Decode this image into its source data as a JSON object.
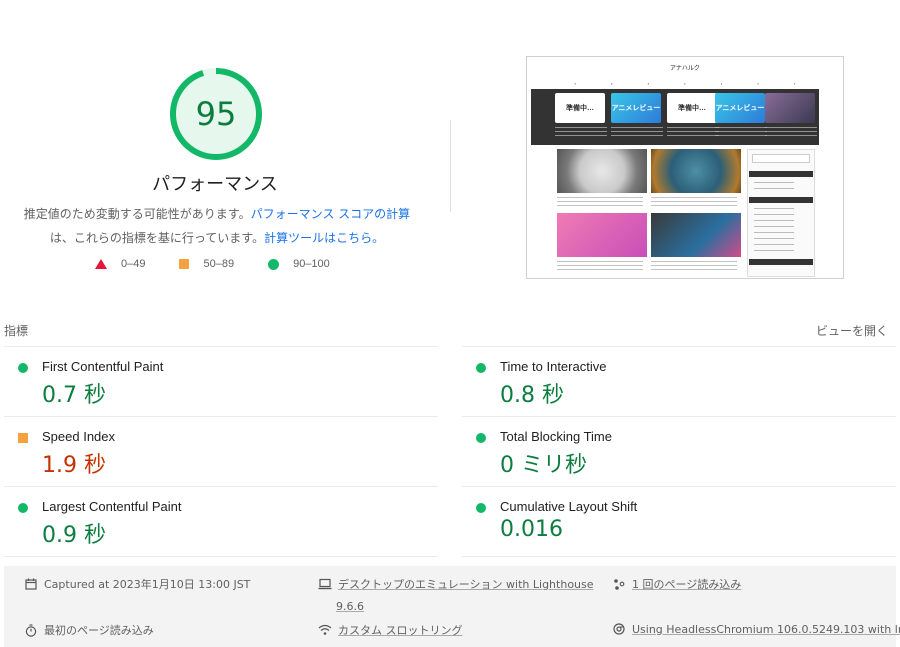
{
  "gauge": {
    "score": "95",
    "score_value": 95,
    "title": "パフォーマンス",
    "desc_prefix": "推定値のため変動する可能性があります。",
    "desc_link1": "パフォーマンス スコアの計算",
    "desc_middle": "は、これらの指標を基に行っています。",
    "desc_link2": "計算ツールはこちら。",
    "color": "#0c7d3f"
  },
  "legend": [
    {
      "label": "0–49",
      "color": "#e8163a"
    },
    {
      "label": "50–89",
      "color": "#f4a23e"
    },
    {
      "label": "90–100",
      "color": "#12b868"
    }
  ],
  "thumbnail": {
    "site_title": "アナハルク",
    "cards": [
      "準備中…",
      "アニメレビュー",
      "準備中…",
      "アニメレビュー"
    ]
  },
  "metrics_header": {
    "title": "指標",
    "toggle": "ビューを開く"
  },
  "metrics": [
    {
      "name": "First Contentful Paint",
      "value": "0.7 秒",
      "rating": "good"
    },
    {
      "name": "Time to Interactive",
      "value": "0.8 秒",
      "rating": "good"
    },
    {
      "name": "Speed Index",
      "value": "1.9 秒",
      "rating": "average"
    },
    {
      "name": "Total Blocking Time",
      "value": "0 ミリ秒",
      "rating": "good"
    },
    {
      "name": "Largest Contentful Paint",
      "value": "0.9 秒",
      "rating": "good"
    },
    {
      "name": "Cumulative Layout Shift",
      "value": "0.016",
      "rating": "good"
    }
  ],
  "footer": {
    "captured": "Captured at 2023年1月10日 13:00 JST",
    "emulation": "デスクトップのエミュレーション with Lighthouse",
    "emulation_version": "9.6.6",
    "page_loads": "1 回のページ読み込み",
    "initial_load": "最初のページ読み込み",
    "throttling": "カスタム スロットリング",
    "browser": "Using HeadlessChromium 106.0.5249.103 with lr"
  },
  "colors": {
    "good": "#0c7d3f",
    "average": "#c33300",
    "link": "#1a73e8"
  }
}
